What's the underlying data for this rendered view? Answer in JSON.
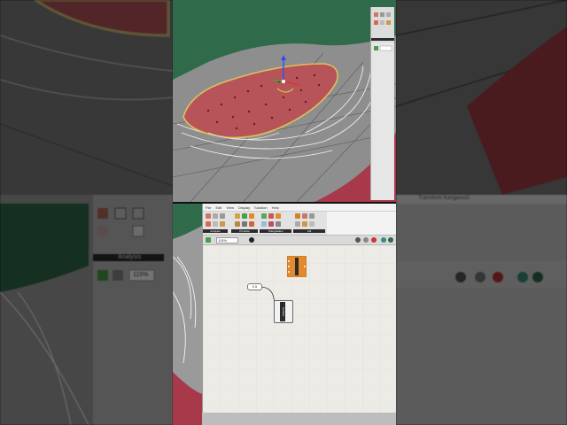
{
  "colors": {
    "surface_red": "#b6545a",
    "surface_green": "#2f6b4a",
    "background_gray": "#8f8f8f",
    "canvas_bg": "#ecebe6",
    "gh_orange": "#e38a2c",
    "panel_dark": "#2b2b2b"
  },
  "gh_menu": [
    "File",
    "Edit",
    "View",
    "Display",
    "Solution",
    "Help"
  ],
  "ribbon_panels": [
    "Analysis",
    "Primitive",
    "Triangulation",
    "Util"
  ],
  "canvas_toolbar": {
    "zoom": "115%"
  },
  "nodes": {
    "panel_value": "0.5",
    "component_label": "Surface"
  },
  "left_panel": {
    "analysis_label": "Analysis",
    "zoom": "115%"
  },
  "right_panel": {
    "tabs": "Transform  Kangaroo2"
  },
  "icons": [
    "gizmo-icon",
    "preview-icon",
    "bake-icon",
    "solve-icon"
  ]
}
